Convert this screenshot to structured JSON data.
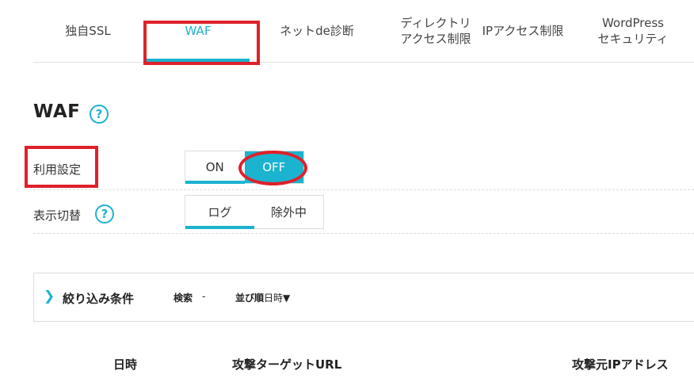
{
  "tabs": [
    {
      "label": "独自SSL",
      "active": false
    },
    {
      "label": "WAF",
      "active": true
    },
    {
      "label": "ネットde診断",
      "active": false
    },
    {
      "label": "ディレクトリ\nアクセス制限",
      "active": false
    },
    {
      "label": "IPアクセス制限",
      "active": false
    },
    {
      "label": "WordPress\nセキュリティ",
      "active": false
    }
  ],
  "page": {
    "title": "WAF",
    "help_icon": "?"
  },
  "settings": {
    "usage": {
      "label": "利用設定",
      "on_label": "ON",
      "off_label": "OFF",
      "selected": "OFF"
    },
    "display": {
      "label": "表示切替",
      "help_icon": "?",
      "log_label": "ログ",
      "excluded_label": "除外中",
      "selected": "ログ"
    }
  },
  "filter": {
    "chevron": "❯",
    "title": "絞り込み条件",
    "search_label": "検索",
    "search_value": "-",
    "sort_label": "並び順",
    "sort_value": "日時▼"
  },
  "table": {
    "headers": [
      "日時",
      "攻撃ターゲットURL",
      "攻撃元IPアドレス"
    ]
  },
  "colors": {
    "accent": "#1bb3cf",
    "annotation": "#e0202a"
  }
}
